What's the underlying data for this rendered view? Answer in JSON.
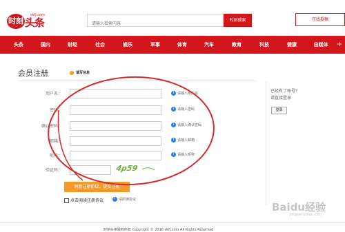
{
  "header": {
    "logo_mark": "时刻",
    "logo_text": "头条",
    "logo_domain": "skfj.com",
    "search_placeholder": "请输入检索内容",
    "search_button": "时刻搜索",
    "complaint_button": "在线投稿"
  },
  "nav": {
    "items": [
      "头条",
      "国内",
      "财经",
      "社会",
      "娱乐",
      "军事",
      "体育",
      "汽车",
      "教育",
      "科技",
      "健康",
      "自媒体"
    ],
    "more": "+"
  },
  "page": {
    "title": "会员注册",
    "fill_info": "填写信息"
  },
  "form": {
    "username": {
      "label": "用户名：",
      "hint": "请输入用户名"
    },
    "password": {
      "label": "密码：",
      "hint": "请输入密码"
    },
    "confirm": {
      "label": "确认密码：",
      "hint": "请输入确认密码"
    },
    "email": {
      "label": "邮箱：",
      "hint": "请输入邮箱"
    },
    "nickname": {
      "label": "昵称：",
      "hint": "请输入昵称"
    },
    "captcha": {
      "label": "验证码：",
      "image_text": "4p59"
    },
    "submit": "同意注册协议，提交注册",
    "agree_label": "点击阅读注册协议",
    "agree_hint": "请阅读协议"
  },
  "side": {
    "line1": "已经有了账号？",
    "line2": "请直接登录",
    "login_button": "登录"
  },
  "footer": {
    "text": "时刻头条版权所有 Copyright © 2016 skfj.com All Rights Reserved"
  },
  "colors": {
    "brand": "#d2161b",
    "submit": "#f39a29",
    "info": "#2f7fd6",
    "annotation": "#d42a2a"
  },
  "watermark": {
    "text": "Baidu经验",
    "sub": "jingyan.baidu.com"
  }
}
